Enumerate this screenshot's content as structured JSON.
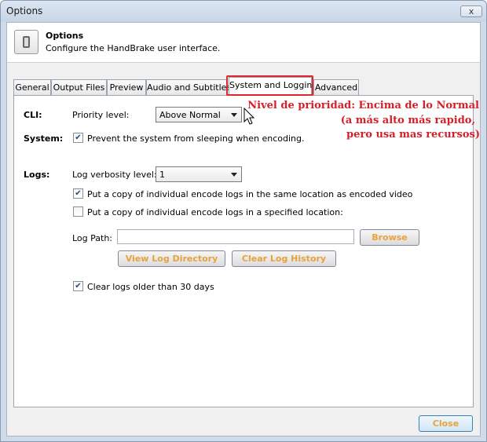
{
  "window": {
    "title": "Options",
    "close_glyph": "x"
  },
  "header": {
    "title": "Options",
    "subtitle": "Configure the HandBrake user interface."
  },
  "tabs": [
    {
      "label": "General"
    },
    {
      "label": "Output Files"
    },
    {
      "label": "Preview"
    },
    {
      "label": "Audio and Subtitles"
    },
    {
      "label": "System and Logging"
    },
    {
      "label": "Advanced"
    }
  ],
  "active_tab": "System and Logging",
  "cli": {
    "section_label": "CLI:",
    "priority_label": "Priority level:",
    "priority_value": "Above Normal"
  },
  "system": {
    "section_label": "System:",
    "prevent_sleep_label": "Prevent the system from sleeping when encoding.",
    "prevent_sleep_checked": true
  },
  "logs": {
    "section_label": "Logs:",
    "verbosity_label": "Log verbosity level:",
    "verbosity_value": "1",
    "copy_same_label": "Put a copy of individual encode logs in the same location as encoded video",
    "copy_same_checked": true,
    "copy_specified_label": "Put a copy of individual encode logs in a specified location:",
    "copy_specified_checked": false,
    "log_path_label": "Log Path:",
    "log_path_value": "",
    "browse_label": "Browse",
    "view_dir_label": "View Log Directory",
    "clear_history_label": "Clear Log History",
    "clear_old_label": "Clear logs older than 30 days",
    "clear_old_checked": true
  },
  "annotation": {
    "line1": "Nivel de prioridad: Encima de lo Normal",
    "line2": "(a más alto más rapido,",
    "line3": "pero usa mas recursos)",
    "color": "#d4202a"
  },
  "footer": {
    "close_label": "Close"
  },
  "colors": {
    "button_text": "#e8a23c",
    "highlight": "#e0262e"
  }
}
